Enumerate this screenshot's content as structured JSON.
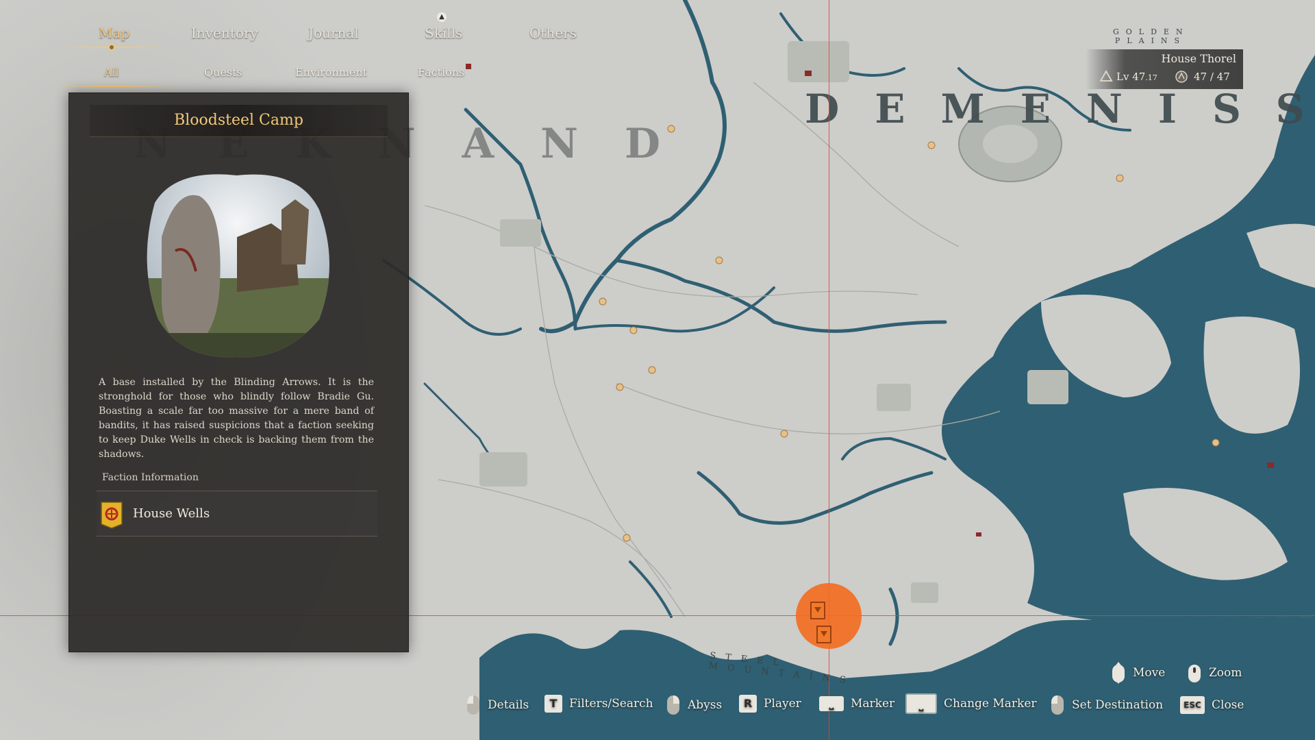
{
  "nav": {
    "tabs": [
      {
        "label": "Map",
        "active": true
      },
      {
        "label": "Inventory",
        "active": false
      },
      {
        "label": "Journal",
        "active": false
      },
      {
        "label": "Skills",
        "active": false
      },
      {
        "label": "Others",
        "active": false
      }
    ],
    "skills_badge": "▲",
    "subtabs": [
      {
        "label": "All",
        "active": true
      },
      {
        "label": "Quests",
        "active": false
      },
      {
        "label": "Environment",
        "active": false
      },
      {
        "label": "Factions",
        "active": false
      }
    ]
  },
  "map": {
    "regions": [
      "NEKNAND",
      "DEMENISS"
    ],
    "golden_plains": "GOLDEN PLAINS",
    "steel_mountains": "STEEL MOUNTAINS"
  },
  "panel": {
    "title": "Bloodsteel Camp",
    "description": "A base installed by the Blinding Arrows. It is the stronghold for those who blindly follow Bradie Gu. Boasting a scale far too massive for a mere band of bandits, it has raised suspicions that a faction seeking to keep Duke Wells in check is backing them from the shadows.",
    "faction_heading": "Faction Information",
    "faction_name": "House Wells",
    "faction_emblem": "house-wells-emblem"
  },
  "player": {
    "house": "House Thorel",
    "level_label": "Lv",
    "level": "47",
    "level_fraction": ".17",
    "troops": "47 / 47"
  },
  "controls": [
    {
      "key": "mouse-left",
      "label": "Details"
    },
    {
      "key": "T",
      "label": "Filters/Search"
    },
    {
      "key": "mouse-right",
      "label": "Abyss"
    },
    {
      "key": "R",
      "label": "Player"
    },
    {
      "key": "space",
      "label": "Marker"
    },
    {
      "key": "space-large",
      "label": "Change Marker"
    },
    {
      "key": "mouse-left",
      "label": "Set Destination"
    },
    {
      "key": "ESC",
      "label": "Close"
    }
  ],
  "controls_top": [
    {
      "key": "mouse-move",
      "label": "Move"
    },
    {
      "key": "mouse-scroll",
      "label": "Zoom"
    }
  ],
  "colors": {
    "accent_gold": "#f3c779",
    "water": "#2f5f72",
    "land": "#cfcfcb",
    "marker_orange": "#f46c1e",
    "crosshair": "#dc4628"
  }
}
